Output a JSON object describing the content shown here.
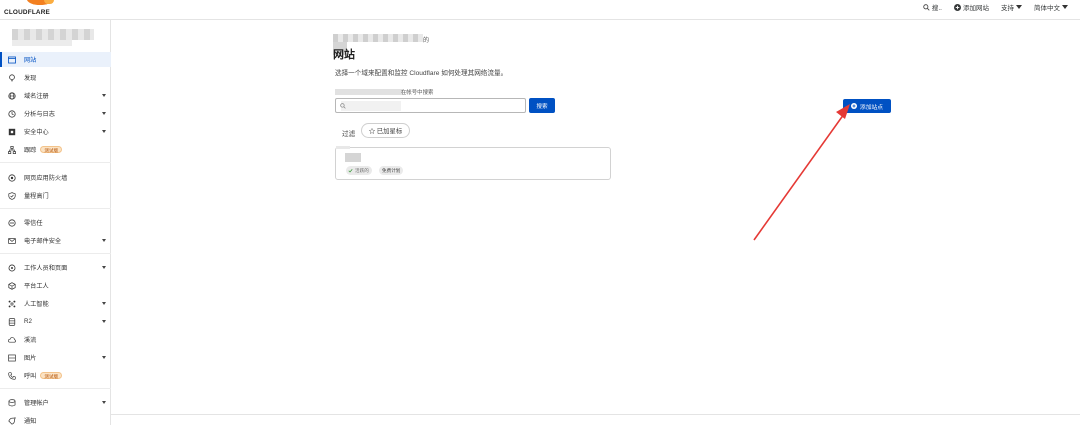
{
  "brand": {
    "wordmark": "CLOUDFLARE",
    "accent": "#f38020",
    "accent2": "#fbad41"
  },
  "topbar": {
    "search_label": "搜..",
    "add_site_label": "添加网站",
    "support_label": "支持",
    "language_label": "简体中文"
  },
  "sidebar": {
    "items": [
      {
        "label": "网站",
        "icon": "browser-window-icon",
        "active": true
      },
      {
        "label": "发现",
        "icon": "lightbulb-icon"
      },
      {
        "label": "域名注册",
        "icon": "globe-icon",
        "caret": true
      },
      {
        "label": "分析与日志",
        "icon": "clock-icon",
        "caret": true
      },
      {
        "label": "安全中心",
        "icon": "shield-square-icon",
        "caret": true
      },
      {
        "label": "跟踪",
        "icon": "network-icon",
        "badge": "测试版"
      },
      {
        "label": "网页应用防火墙",
        "icon": "firewall-icon"
      },
      {
        "label": "量程高门",
        "icon": "shield-check-icon"
      },
      {
        "label": "零信任",
        "icon": "zero-trust-icon"
      },
      {
        "label": "电子邮件安全",
        "icon": "email-icon",
        "caret": true
      },
      {
        "label": "工作人员和页面",
        "icon": "workers-icon",
        "caret": true
      },
      {
        "label": "平台工人",
        "icon": "cube-icon"
      },
      {
        "label": "人工智能",
        "icon": "ai-icon",
        "caret": true
      },
      {
        "label": "R2",
        "icon": "storage-icon",
        "caret": true
      },
      {
        "label": "溪流",
        "icon": "cloud-stream-icon"
      },
      {
        "label": "图片",
        "icon": "image-icon",
        "caret": true
      },
      {
        "label": "呼叫",
        "icon": "phone-icon",
        "badge": "测试版"
      },
      {
        "label": "管理帐户",
        "icon": "account-icon",
        "caret": true
      },
      {
        "label": "通知",
        "icon": "notification-icon"
      }
    ]
  },
  "main": {
    "title": "网站",
    "title_suffix": "的",
    "description": "选择一个域来配置和监控 Cloudflare 如何处理其网络流量。",
    "search_hint": "在帐号中搜索",
    "search_button": "搜索",
    "filter_label": "过滤",
    "filter_chip": "已加星标",
    "site_card": {
      "status": "活跃的",
      "plan": "免费计划"
    },
    "add_site_button": "添加站点",
    "colors": {
      "primary": "#0051c3",
      "annotation_arrow": "#e53935"
    }
  }
}
